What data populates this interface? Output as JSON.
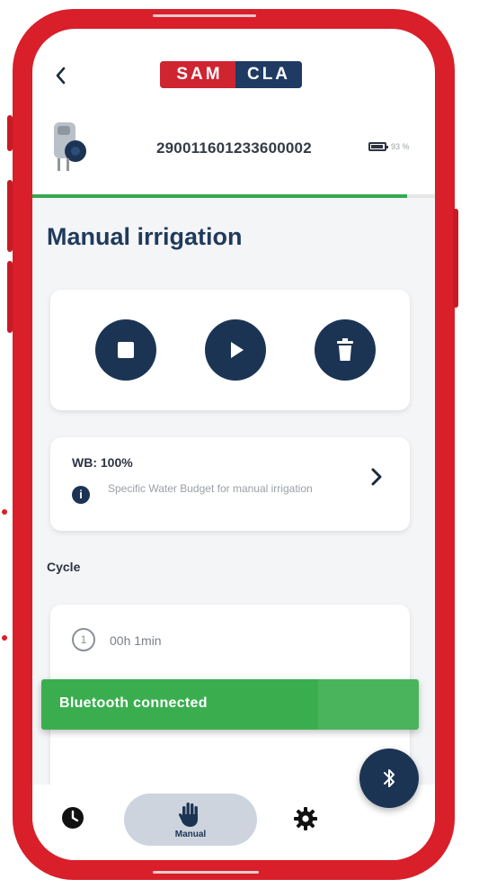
{
  "app": {
    "logo_part1": "SAM",
    "logo_part2": "CLA"
  },
  "header": {
    "back_icon": "chevron-left-icon",
    "serial_number": "290011601233600002",
    "battery_text": "93 %",
    "battery_level": 0.93,
    "progress_fraction": 0.93
  },
  "page": {
    "title": "Manual irrigation"
  },
  "controls": {
    "stop_icon": "stop-icon",
    "play_icon": "play-icon",
    "delete_icon": "trash-icon"
  },
  "water_budget": {
    "label": "WB: 100%",
    "description": "Specific Water Budget for manual irrigation"
  },
  "cycle": {
    "section_label": "Cycle",
    "index": "1",
    "duration": "00h 1min"
  },
  "snackbar": {
    "message": "Bluetooth connected"
  },
  "bottom_nav": {
    "manual_label": "Manual",
    "history_icon": "clock-icon",
    "manual_icon": "hand-icon",
    "settings_icon": "gear-icon"
  },
  "colors": {
    "frame": "#d81f2a",
    "navy": "#1c3454",
    "green": "#3aae4f",
    "progress": "#35a853"
  }
}
